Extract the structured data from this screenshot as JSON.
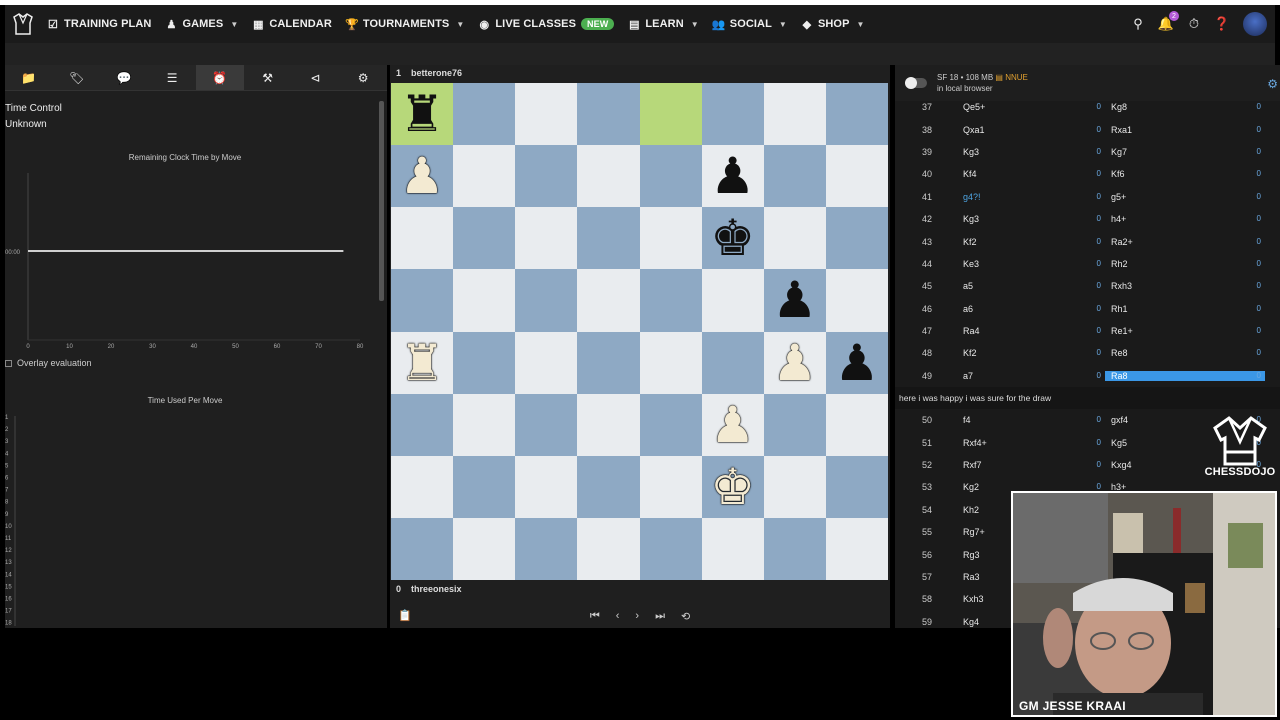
{
  "nav": {
    "items": [
      {
        "label": "TRAINING PLAN",
        "icon": "checklist-icon",
        "chevron": false
      },
      {
        "label": "GAMES",
        "icon": "pawn-icon",
        "chevron": true
      },
      {
        "label": "CALENDAR",
        "icon": "calendar-icon",
        "chevron": false
      },
      {
        "label": "TOURNAMENTS",
        "icon": "trophy-icon",
        "chevron": true
      },
      {
        "label": "LIVE CLASSES",
        "icon": "broadcast-icon",
        "chevron": false,
        "badge": "NEW"
      },
      {
        "label": "LEARN",
        "icon": "book-icon",
        "chevron": true
      },
      {
        "label": "SOCIAL",
        "icon": "people-icon",
        "chevron": true
      },
      {
        "label": "SHOP",
        "icon": "tag-icon",
        "chevron": true
      }
    ],
    "notification_count": "2"
  },
  "left": {
    "tabs": [
      "folder-icon",
      "tag-icon",
      "comment-icon",
      "list-icon",
      "clock-icon",
      "tools-icon",
      "share-icon",
      "gear-icon"
    ],
    "active_tab": 4,
    "time_control_label": "Time Control",
    "time_control_value": "Unknown",
    "clock_chart_title": "Remaining Clock Time by Move",
    "overlay_label": "Overlay evaluation",
    "used_chart_title": "Time Used Per Move"
  },
  "chart_data": [
    {
      "type": "line",
      "title": "Remaining Clock Time by Move",
      "x": [
        0,
        76
      ],
      "y": [
        0,
        0
      ],
      "xticks": [
        "0",
        "10",
        "20",
        "30",
        "40",
        "50",
        "60",
        "70",
        "80"
      ],
      "yticks": [
        "00:00"
      ],
      "xlim": [
        0,
        80
      ]
    },
    {
      "type": "bar",
      "title": "Time Used Per Move",
      "categories": [
        "1",
        "2",
        "3",
        "4",
        "5",
        "6",
        "7",
        "8",
        "9",
        "10",
        "11",
        "12",
        "13",
        "14",
        "15",
        "16",
        "17",
        "18"
      ],
      "values": [],
      "grid": false
    }
  ],
  "board": {
    "top_player": {
      "score": "1",
      "name": "betterone76"
    },
    "bottom_player": {
      "score": "0",
      "name": "threeonesix"
    },
    "highlight_squares": [
      [
        0,
        0
      ],
      [
        0,
        4
      ]
    ],
    "pieces": [
      {
        "glyph": "♜",
        "color": "b",
        "row": 0,
        "col": 0
      },
      {
        "glyph": "♟",
        "color": "w",
        "row": 1,
        "col": 0
      },
      {
        "glyph": "♟",
        "color": "b",
        "row": 1,
        "col": 5
      },
      {
        "glyph": "♚",
        "color": "b",
        "row": 2,
        "col": 5
      },
      {
        "glyph": "♟",
        "color": "b",
        "row": 3,
        "col": 6
      },
      {
        "glyph": "♜",
        "color": "w",
        "row": 4,
        "col": 0
      },
      {
        "glyph": "♟",
        "color": "w",
        "row": 4,
        "col": 6
      },
      {
        "glyph": "♟",
        "color": "b",
        "row": 4,
        "col": 7
      },
      {
        "glyph": "♟",
        "color": "w",
        "row": 5,
        "col": 5
      },
      {
        "glyph": "♚",
        "color": "w",
        "row": 6,
        "col": 5
      }
    ],
    "controls": [
      "⏮",
      "‹",
      "›",
      "⏭",
      "⟲"
    ]
  },
  "engine": {
    "name": "SF 18 • 108 MB",
    "nnue": "NNUE",
    "location": "in local browser"
  },
  "moves_top": [
    {
      "n": "37",
      "w": "Qe5+",
      "we": "0",
      "b": "Kg8",
      "be": "0"
    },
    {
      "n": "38",
      "w": "Qxa1",
      "we": "0",
      "b": "Rxa1",
      "be": "0"
    },
    {
      "n": "39",
      "w": "Kg3",
      "we": "0",
      "b": "Kg7",
      "be": "0"
    },
    {
      "n": "40",
      "w": "Kf4",
      "we": "0",
      "b": "Kf6",
      "be": "0"
    },
    {
      "n": "41",
      "w": "g4?!",
      "we": "0",
      "b": "g5+",
      "be": "0",
      "dubious": true
    },
    {
      "n": "42",
      "w": "Kg3",
      "we": "0",
      "b": "h4+",
      "be": "0"
    },
    {
      "n": "43",
      "w": "Kf2",
      "we": "0",
      "b": "Ra2+",
      "be": "0"
    },
    {
      "n": "44",
      "w": "Ke3",
      "we": "0",
      "b": "Rh2",
      "be": "0"
    },
    {
      "n": "45",
      "w": "a5",
      "we": "0",
      "b": "Rxh3",
      "be": "0"
    },
    {
      "n": "46",
      "w": "a6",
      "we": "0",
      "b": "Rh1",
      "be": "0"
    },
    {
      "n": "47",
      "w": "Ra4",
      "we": "0",
      "b": "Re1+",
      "be": "0"
    },
    {
      "n": "48",
      "w": "Kf2",
      "we": "0",
      "b": "Re8",
      "be": "0"
    },
    {
      "n": "49",
      "w": "a7",
      "we": "0",
      "b": "Ra8",
      "be": "0",
      "current": true
    }
  ],
  "comment": "here i was happy i was sure for the draw",
  "moves_bottom": [
    {
      "n": "50",
      "w": "f4",
      "we": "0",
      "b": "gxf4",
      "be": "0"
    },
    {
      "n": "51",
      "w": "Rxf4+",
      "we": "0",
      "b": "Kg5",
      "be": "0"
    },
    {
      "n": "52",
      "w": "Rxf7",
      "we": "0",
      "b": "Kxg4",
      "be": "0"
    },
    {
      "n": "53",
      "w": "Kg2",
      "we": "0",
      "b": "h3+",
      "be": ""
    },
    {
      "n": "54",
      "w": "Kh2",
      "we": "",
      "b": "",
      "be": ""
    },
    {
      "n": "55",
      "w": "Rg7+",
      "we": "",
      "b": "",
      "be": ""
    },
    {
      "n": "56",
      "w": "Rg3",
      "we": "",
      "b": "",
      "be": ""
    },
    {
      "n": "57",
      "w": "Ra3",
      "we": "",
      "b": "",
      "be": ""
    },
    {
      "n": "58",
      "w": "Kxh3",
      "we": "",
      "b": "",
      "be": ""
    },
    {
      "n": "59",
      "w": "Kg4",
      "we": "",
      "b": "",
      "be": ""
    }
  ],
  "brand": {
    "name": "CHESSDOJO"
  },
  "webcam": {
    "caption": "GM JESSE KRAAI"
  },
  "colors": {
    "current_move": "#3b97e6",
    "highlight": "#b7d87a",
    "badge_new": "#4caf50",
    "nnue": "#e0a030"
  }
}
